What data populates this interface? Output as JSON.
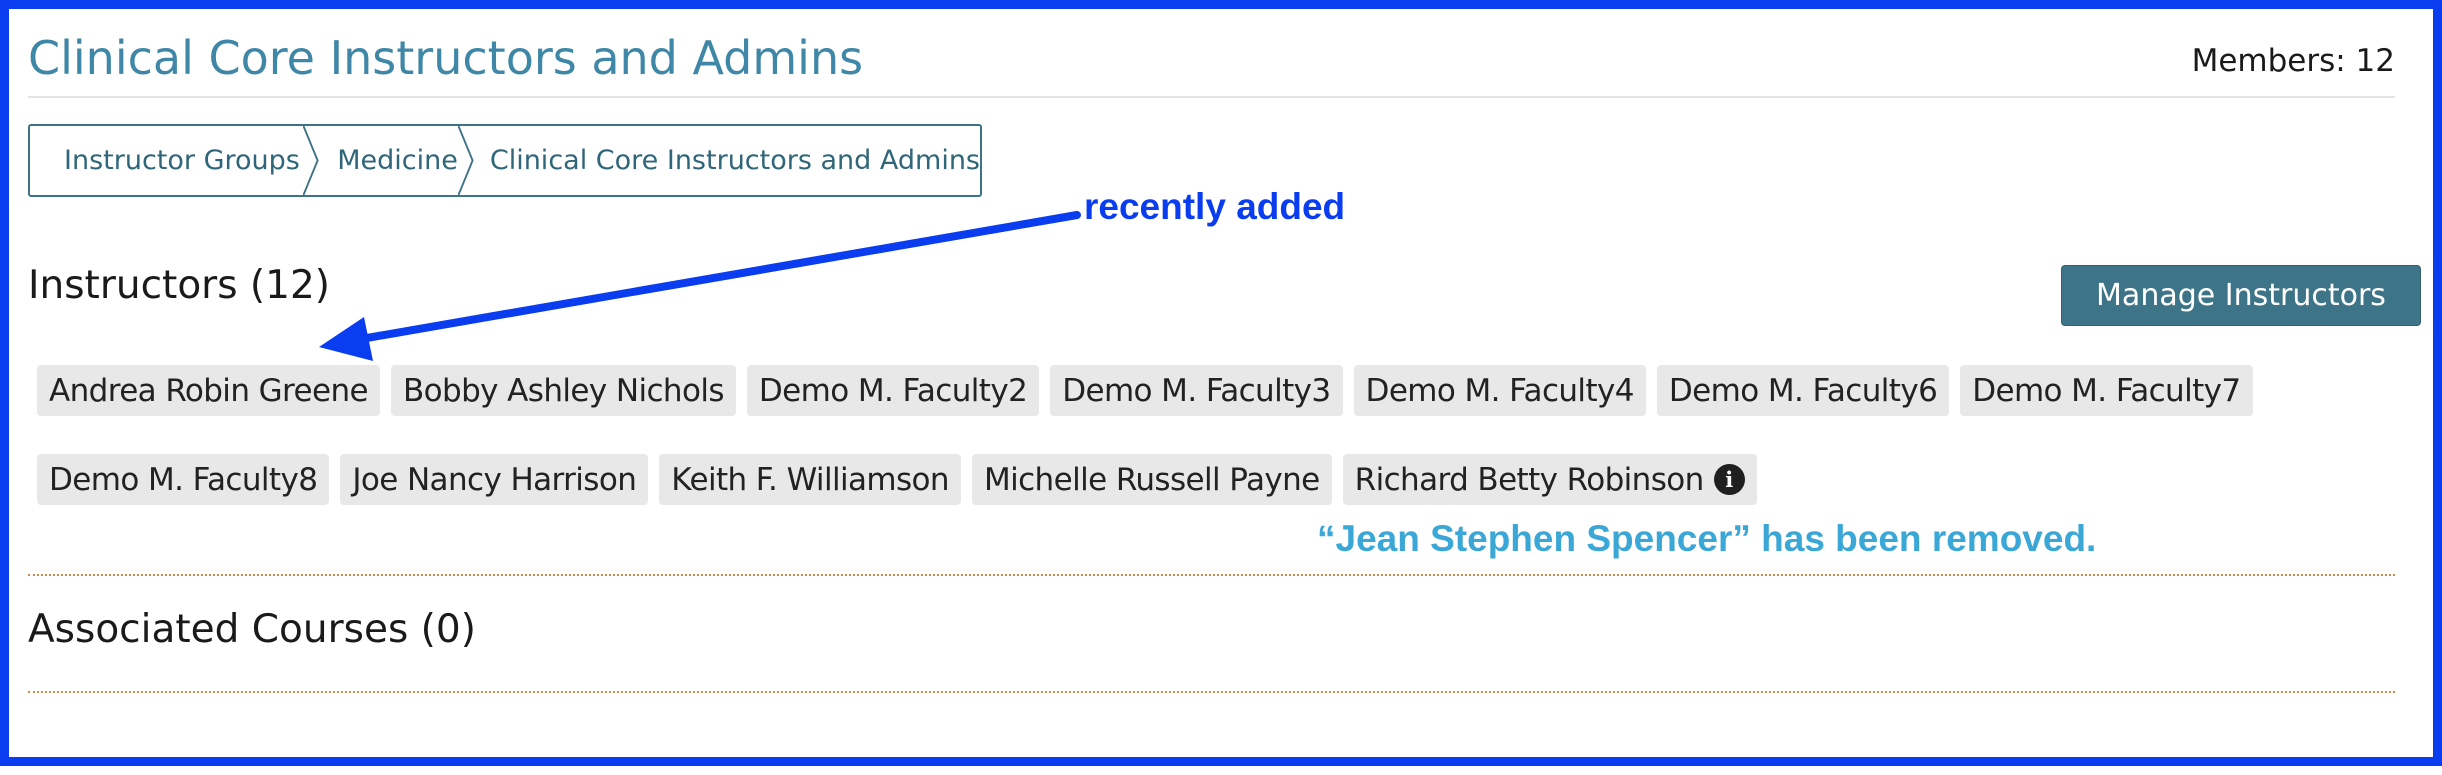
{
  "header": {
    "title": "Clinical Core Instructors and Admins",
    "members": "Members: 12"
  },
  "breadcrumb": {
    "items": [
      {
        "label": "Instructor Groups"
      },
      {
        "label": "Medicine"
      },
      {
        "label": "Clinical Core Instructors and Admins"
      }
    ]
  },
  "annotations": {
    "recently_added": "recently added",
    "removed": "“Jean Stephen Spencer” has been removed."
  },
  "instructors": {
    "title": "Instructors (12)",
    "manage_label": "Manage Instructors",
    "row1": [
      "Andrea Robin Greene",
      "Bobby Ashley Nichols",
      "Demo M. Faculty2",
      "Demo M. Faculty3",
      "Demo M. Faculty4",
      "Demo M. Faculty6",
      "Demo M. Faculty7"
    ],
    "row2": [
      "Demo M. Faculty8",
      "Joe Nancy Harrison",
      "Keith F. Williamson",
      "Michelle Russell Payne",
      "Richard Betty Robinson"
    ],
    "info_icon_glyph": "i"
  },
  "courses": {
    "title": "Associated Courses (0)"
  },
  "colors": {
    "frame": "#0a3df0",
    "title": "#3f87a6",
    "button": "#3e7487",
    "chip": "#e8e8e8",
    "annotation_added": "#0a3df0",
    "annotation_removed": "#3aa7d6"
  }
}
